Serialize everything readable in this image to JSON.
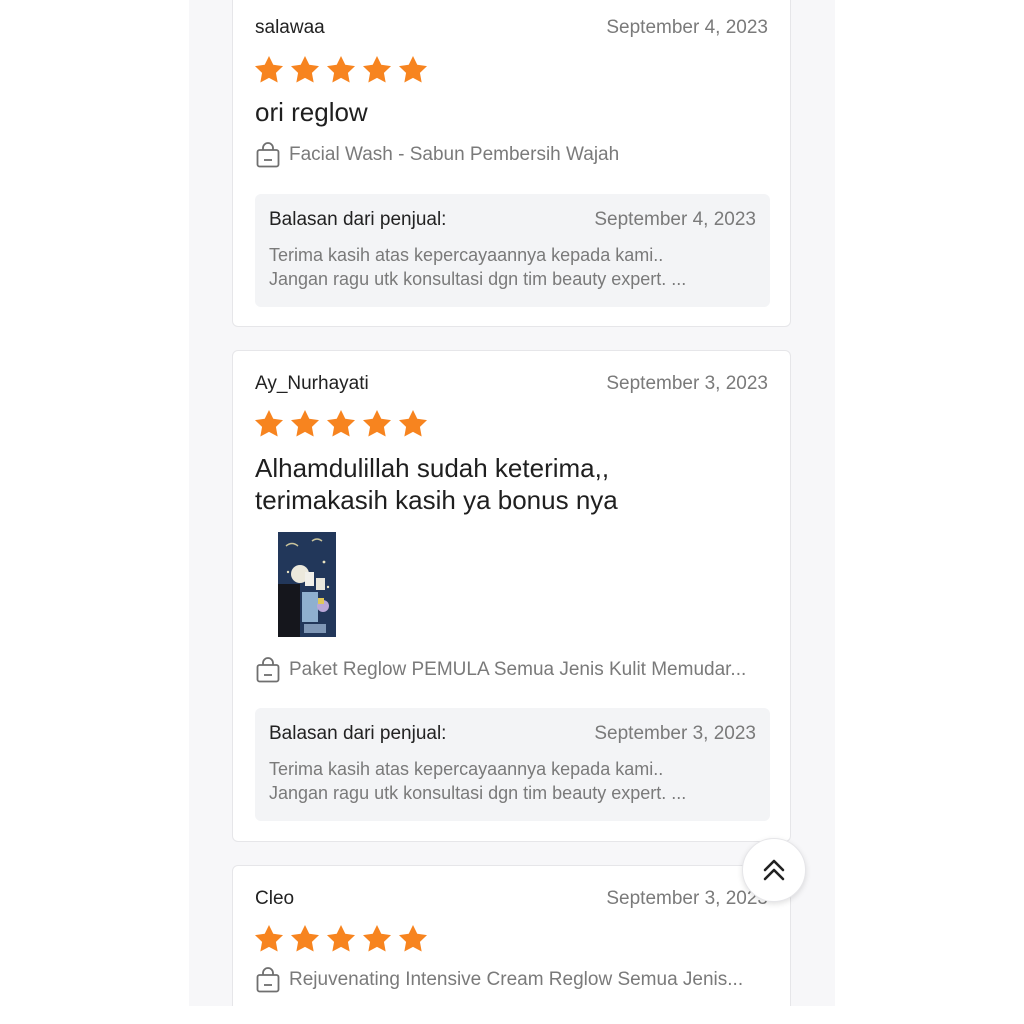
{
  "colors": {
    "star": "#f7841f",
    "panel_bg": "#f7f7f9",
    "reply_bg": "#f3f4f6",
    "muted_text": "#7a7a7a"
  },
  "icons": {
    "star": "star-icon",
    "bag": "shopping-bag-icon",
    "back_to_top": "double-chevron-up-icon"
  },
  "reviews": [
    {
      "user": "salawaa",
      "date": "September 4, 2023",
      "rating": 5,
      "text": "ori reglow",
      "product": "Facial Wash - Sabun Pembersih Wajah",
      "reply": {
        "label": "Balasan dari penjual:",
        "date": "September 4, 2023",
        "line1": "Terima kasih atas kepercayaannya kepada kami..",
        "line2": "Jangan ragu utk konsultasi dgn tim beauty expert. ..."
      }
    },
    {
      "user": "Ay_Nurhayati",
      "date": "September 3, 2023",
      "rating": 5,
      "text_line1": "Alhamdulillah sudah keterima,,",
      "text_line2": "terimakasih kasih ya bonus nya",
      "product": "Paket Reglow PEMULA Semua Jenis Kulit Memudar...",
      "reply": {
        "label": "Balasan dari penjual:",
        "date": "September 3, 2023",
        "line1": "Terima kasih atas kepercayaannya kepada kami..",
        "line2": "Jangan ragu utk konsultasi dgn tim beauty expert. ..."
      }
    },
    {
      "user": "Cleo",
      "date": "September 3, 2023",
      "rating": 5,
      "product": "Rejuvenating Intensive Cream Reglow Semua Jenis..."
    }
  ]
}
